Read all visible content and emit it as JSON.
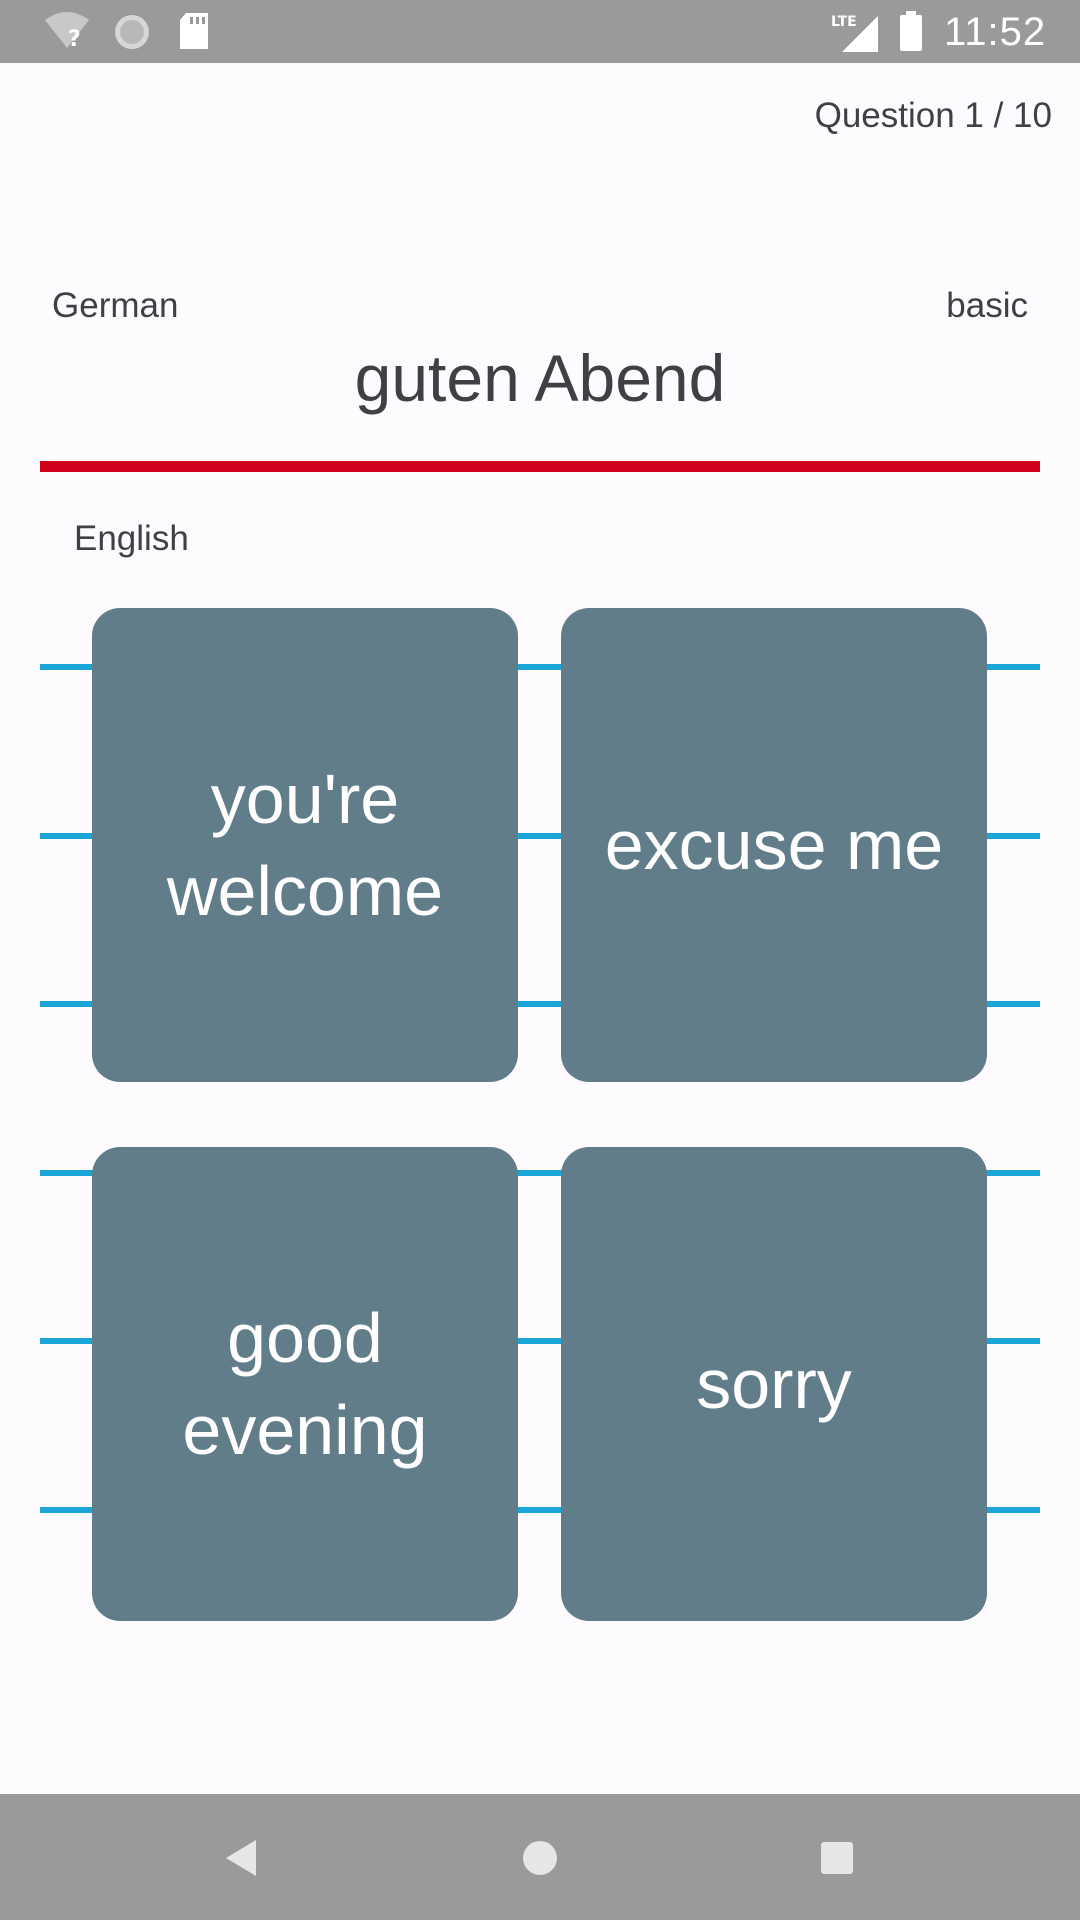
{
  "status_bar": {
    "time": "11:52",
    "network_label": "LTE",
    "icons": [
      "wifi-unknown-icon",
      "sync-icon",
      "sd-card-icon",
      "lte-signal-icon",
      "battery-icon"
    ]
  },
  "header": {
    "question_counter": "Question 1 / 10",
    "source_language": "German",
    "level": "basic",
    "prompt_word": "guten Abend",
    "target_language": "English"
  },
  "answers": [
    {
      "label": "you're welcome"
    },
    {
      "label": "excuse me"
    },
    {
      "label": "good evening"
    },
    {
      "label": "sorry"
    }
  ],
  "nav_bar": {
    "icons": [
      "back-icon",
      "home-icon",
      "recents-icon"
    ]
  },
  "colors": {
    "status_bar": "#9b9a9b",
    "timer_bar": "#d0021b",
    "card": "#627d8a",
    "rail": "#1aa4d8",
    "text": "#3f3f46",
    "background": "#fefbfe"
  }
}
